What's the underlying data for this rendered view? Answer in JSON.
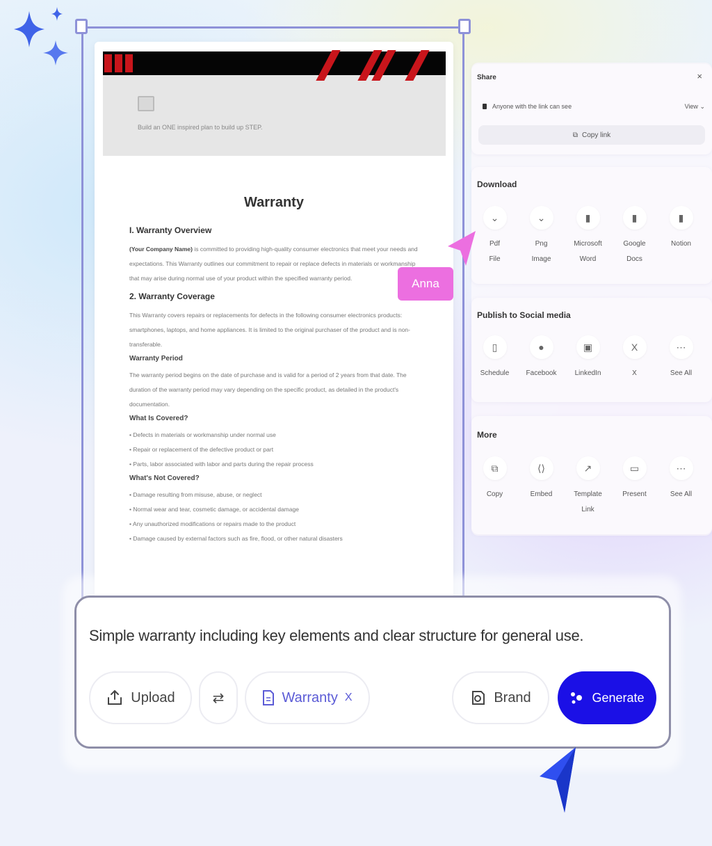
{
  "document": {
    "banner_caption": "Build an ONE inspired plan to build up STEP.",
    "title": "Warranty",
    "sections": [
      {
        "type": "heading",
        "text": "I. Warranty Overview"
      },
      {
        "type": "para",
        "lead": "(Your Company Name)",
        "text": " is committed to providing high-quality consumer electronics that meet your needs and expectations. This Warranty outlines our commitment to repair or replace defects in materials or workmanship that may arise during normal use of your product within the specified warranty period."
      },
      {
        "type": "heading",
        "text": "2. Warranty Coverage"
      },
      {
        "type": "para",
        "lead": "",
        "text": "This Warranty covers repairs or replacements for defects in the following consumer electronics products: smartphones, laptops, and home appliances. It is limited to the original purchaser of the product and is non-transferable."
      },
      {
        "type": "sub",
        "text": "Warranty Period"
      },
      {
        "type": "para",
        "lead": "",
        "text": "The warranty period begins on the date of purchase and is valid for a period of 2 years from that date. The duration of the warranty period may vary depending on the specific product, as detailed in the product's documentation."
      },
      {
        "type": "sub",
        "text": "What Is Covered?"
      },
      {
        "type": "bullet",
        "text": "• Defects in materials or workmanship under normal use"
      },
      {
        "type": "bullet",
        "text": "• Repair or replacement of the defective product or part"
      },
      {
        "type": "bullet",
        "text": "• Parts, labor associated with labor and parts during the repair process"
      },
      {
        "type": "sub",
        "text": "What's Not Covered?"
      },
      {
        "type": "bullet",
        "text": "• Damage resulting from misuse, abuse, or neglect"
      },
      {
        "type": "bullet",
        "text": "• Normal wear and tear, cosmetic damage, or accidental damage"
      },
      {
        "type": "bullet",
        "text": "• Any unauthorized modifications or repairs made to the product"
      },
      {
        "type": "bullet",
        "text": "• Damage caused by external factors such as fire, flood, or other natural disasters"
      }
    ]
  },
  "collaborator": {
    "name": "Anna",
    "color": "#ec6fe0"
  },
  "share": {
    "title": "Share",
    "close_icon": "close-icon",
    "access_text": "Anyone with the link can see",
    "permission": "View",
    "copy_link_label": "Copy link"
  },
  "download": {
    "title": "Download",
    "items": [
      {
        "icon": "pdf-icon",
        "glyph": "⌄",
        "label1": "Pdf",
        "label2": "File"
      },
      {
        "icon": "png-icon",
        "glyph": "⌄",
        "label1": "Png",
        "label2": "Image"
      },
      {
        "icon": "word-icon",
        "glyph": "▮",
        "label1": "Microsoft",
        "label2": "Word"
      },
      {
        "icon": "google-docs-icon",
        "glyph": "▮",
        "label1": "Google",
        "label2": "Docs"
      },
      {
        "icon": "notion-icon",
        "glyph": "▮",
        "label1": "Notion",
        "label2": ""
      }
    ]
  },
  "social": {
    "title": "Publish to Social media",
    "items": [
      {
        "icon": "schedule-icon",
        "glyph": "▯",
        "label": "Schedule"
      },
      {
        "icon": "facebook-icon",
        "glyph": "●",
        "label": "Facebook"
      },
      {
        "icon": "linkedin-icon",
        "glyph": "▣",
        "label": "LinkedIn"
      },
      {
        "icon": "x-icon",
        "glyph": "X",
        "label": "X"
      },
      {
        "icon": "more-icon",
        "glyph": "⋯",
        "label": "See All"
      }
    ]
  },
  "more": {
    "title": "More",
    "items": [
      {
        "icon": "copy-icon",
        "glyph": "⧉",
        "label1": "Copy",
        "label2": ""
      },
      {
        "icon": "embed-icon",
        "glyph": "⟨⟩",
        "label1": "Embed",
        "label2": ""
      },
      {
        "icon": "template-link-icon",
        "glyph": "↗",
        "label1": "Template",
        "label2": "Link"
      },
      {
        "icon": "present-icon",
        "glyph": "▭",
        "label1": "Present",
        "label2": ""
      },
      {
        "icon": "more-icon",
        "glyph": "⋯",
        "label1": "See All",
        "label2": ""
      }
    ]
  },
  "prompt": {
    "text": "Simple warranty including key elements and clear structure for general use.",
    "upload_label": "Upload",
    "attachment_label": "Warranty",
    "attachment_remove": "X",
    "brand_label": "Brand",
    "generate_label": "Generate"
  },
  "colors": {
    "accent": "#1b10e6",
    "selection": "#8e92d8",
    "cursor_blue": "#2f4ff0",
    "cursor_pink": "#ec6fe0"
  }
}
